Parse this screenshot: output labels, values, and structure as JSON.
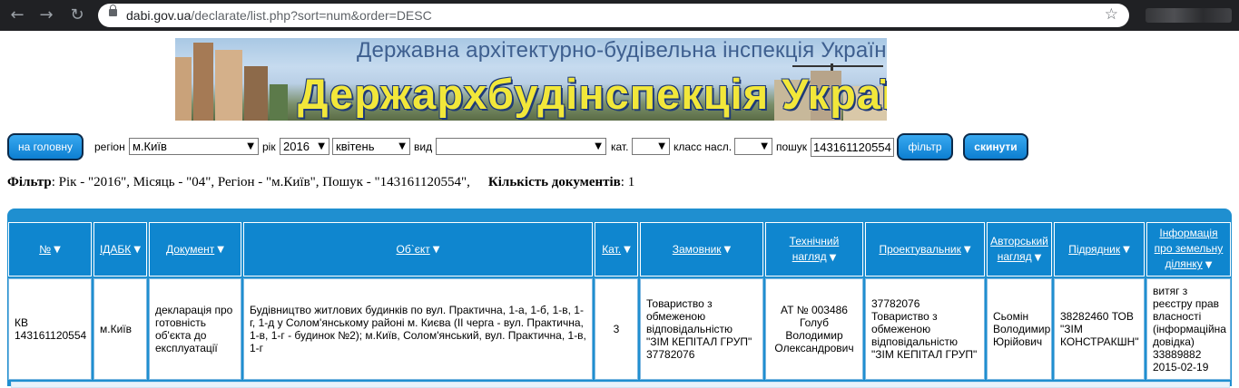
{
  "browser": {
    "url_host": "dabi.gov.ua",
    "url_path": "/declarate/list.php?sort=num&order=DESC"
  },
  "banner": {
    "subtitle": "Державна архітектурно-будівельна інспекція України",
    "title": "Держархбудінспекція України"
  },
  "filters": {
    "home_button": "на головну",
    "region_label": "регіон",
    "region_value": "м.Київ",
    "year_label": "рік",
    "year_value": "2016",
    "month_value": "квітень",
    "kind_label": "вид",
    "kind_value": "",
    "cat_label": "кат.",
    "cat_value": "",
    "class_label": "класс насл.",
    "class_value": "",
    "search_label": "пошук",
    "search_value": "143161120554",
    "filter_button": "фільтр",
    "reset_button": "скинути"
  },
  "summary": {
    "filter_label": "Фільтр",
    "filter_text": ": Рік - \"2016\", Місяць - \"04\", Регіон - \"м.Київ\", Пошук - \"143161120554\",",
    "count_label": "Кількість документів",
    "count_text": ": 1"
  },
  "table": {
    "headers": [
      "№",
      "ІДАБК",
      "Документ",
      "Об`єкт",
      "Кат.",
      "Замовник",
      "Технічний нагляд",
      "Проектувальник",
      "Авторський нагляд",
      "Підрядник",
      "Інформація про земельну ділянку"
    ],
    "rows": [
      [
        "КВ 143161120554",
        "м.Київ",
        "декларація про готовність об'єкта до експлуатації",
        "Будівництво житлових будинків по вул. Практична, 1-а, 1-б, 1-в, 1-г, 1-д у Солом'янському районі м. Києва (II черга - вул. Практична, 1-в, 1-г - будинок №2); м.Київ, Солом'янський, вул. Практична, 1-в, 1-г",
        "3",
        "Товариство з обмеженою відповідальністю \"ЗІМ КЕПІТАЛ ГРУП\" 37782076",
        "АТ № 003486 Голуб Володимир Олександрович",
        "37782076 Товариство з обмеженою відповідальністю \"ЗІМ КЕПІТАЛ ГРУП\"",
        "Сьомін Володимир Юрійович",
        "38282460 ТОВ \"ЗІМ КОНСТРАКШН\"",
        "витяг з реєстру прав власності (інформаційна довідка) 33889882 2015-02-19"
      ]
    ]
  },
  "icons": {
    "back": "back-arrow-icon",
    "forward": "forward-arrow-icon",
    "reload": "reload-icon",
    "lock": "lock-icon",
    "star": "bookmark-star-icon",
    "sort": "sort-triangle-icon"
  }
}
